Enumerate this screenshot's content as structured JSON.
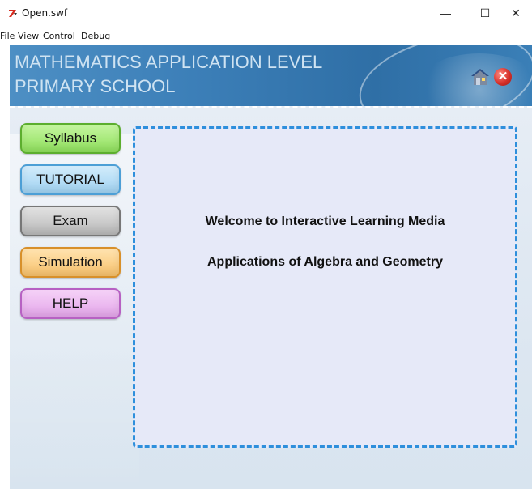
{
  "window": {
    "title": "Open.swf",
    "minimize_glyph": "—",
    "maximize_glyph": "☐",
    "close_glyph": "✕"
  },
  "menu": {
    "items": [
      "File",
      "View",
      "Control",
      "Debug"
    ]
  },
  "header": {
    "line1": "MATHEMATICS APPLICATION LEVEL",
    "line2": "PRIMARY SCHOOL",
    "home_icon": "home-icon",
    "exit_icon": "exit-icon",
    "exit_glyph": "✕"
  },
  "nav": {
    "syllabus": "Syllabus",
    "tutorial": "TUTORIAL",
    "exam": "Exam",
    "simulation": "Simulation",
    "help": "HELP"
  },
  "content": {
    "welcome": "Welcome to Interactive Learning Media",
    "subtitle": "Applications of Algebra and Geometry"
  },
  "colors": {
    "header_blue": "#3c7fb8",
    "panel_border": "#2e8fdc",
    "panel_fill": "#e6e9f8"
  }
}
